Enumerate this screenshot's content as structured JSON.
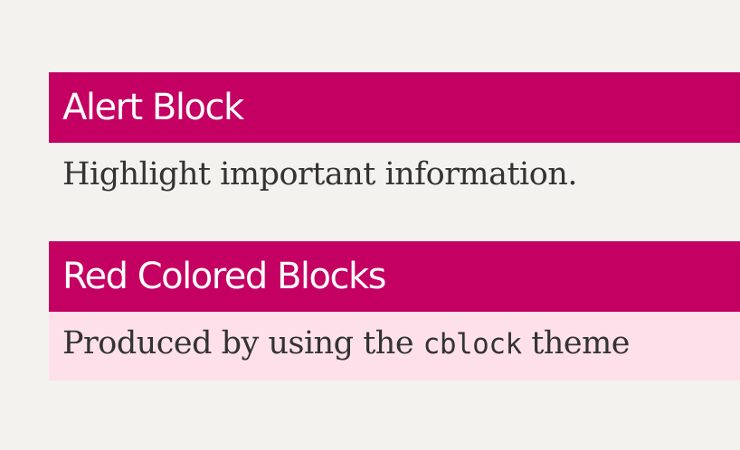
{
  "alert_block": {
    "title": "Alert Block",
    "body": "Highlight important information."
  },
  "red_block": {
    "title": "Red Colored Blocks",
    "body_before": "Produced by using the ",
    "body_code": "cblock",
    "body_after": " theme"
  },
  "colors": {
    "background": "#f4f2ee",
    "title_bar": "#c40063",
    "tinted_body": "#fde0ea",
    "body_text": "#333333"
  }
}
